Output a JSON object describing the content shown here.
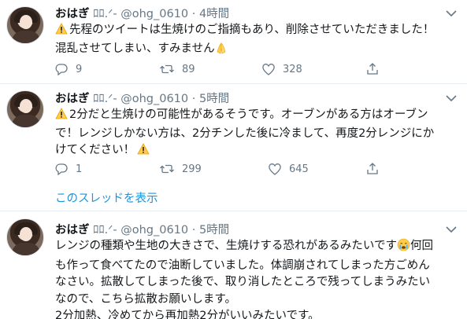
{
  "tweets": [
    {
      "name": "おはぎ",
      "handle_prefix": "ﾛﾛ.ᐟ-",
      "handle": "@ohg_0610",
      "dot": "·",
      "time": "4時間",
      "lines": [
        "先程のツイートは生焼けのご指摘もあり、削除させていただきました！",
        "混乱させてしまい、すみません"
      ],
      "reply_count": "9",
      "retweet_count": "89",
      "like_count": "328"
    },
    {
      "name": "おはぎ",
      "handle_prefix": "ﾛﾛ.ᐟ-",
      "handle": "@ohg_0610",
      "dot": "·",
      "time": "5時間",
      "lines": [
        "2分だと生焼けの可能性があるそうです。オーブンがある方はオーブン",
        "で！レンジしかない方は、2分チンした後に冷まして、再度2分レンジにか",
        "けてください！"
      ],
      "reply_count": "1",
      "retweet_count": "299",
      "like_count": "645"
    },
    {
      "name": "おはぎ",
      "handle_prefix": "ﾛﾛ.ᐟ-",
      "handle": "@ohg_0610",
      "dot": "·",
      "time": "5時間",
      "lines": [
        "レンジの種類や生地の大きさで、生焼けする恐れがあるみたいです",
        "何回",
        "も作って食べてたので油断していました。体調崩されてしまった方ごめん",
        "なさい。拡散してしまった後で、取り消したところで残ってしまうみたい",
        "なので、こちら拡散お願いします。",
        "2分加熱、冷めてから再加熱2分がいいみたいです。"
      ]
    }
  ],
  "thread_link": "このスレッドを表示",
  "icons": [
    "avatar",
    "chevron-down-icon",
    "warning-icon",
    "pray-icon",
    "crying-icon",
    "reply-icon",
    "retweet-icon",
    "like-icon",
    "share-icon"
  ],
  "colors": {
    "text": "#14171a",
    "secondary": "#657786",
    "link": "#1b95e0",
    "divider": "#e6ecf0"
  }
}
